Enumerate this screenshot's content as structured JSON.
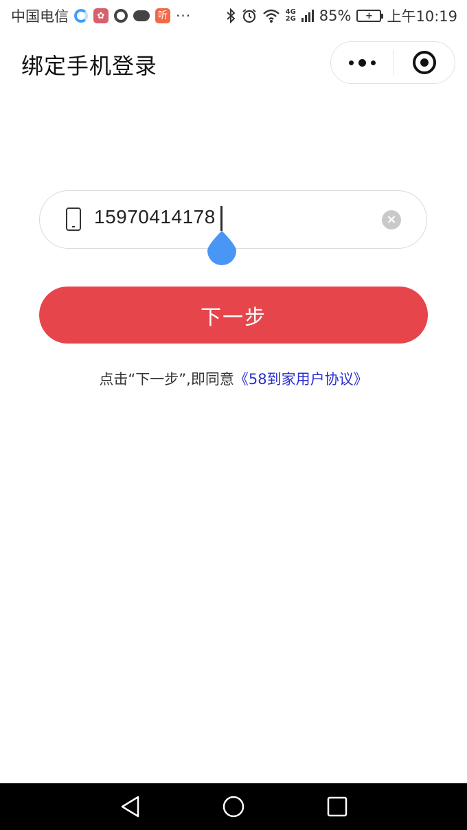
{
  "status_bar": {
    "carrier": "中国电信",
    "listen_icon_text": "听",
    "more_dots": "···",
    "network_top": "4G",
    "network_bottom": "2G",
    "battery": "85%",
    "time": "上午10:19"
  },
  "title_bar": {
    "title": "绑定手机登录"
  },
  "phone_field": {
    "value": "15970414178",
    "clear_symbol": "×"
  },
  "next_button": {
    "label": "下一步"
  },
  "agreement": {
    "prefix": "点击“下一步”,即同意",
    "link": "《58到家用户协议》"
  },
  "colors": {
    "primary_button": "#e6454c",
    "link": "#2a2fd0",
    "drop_handle": "#4a96f5"
  }
}
